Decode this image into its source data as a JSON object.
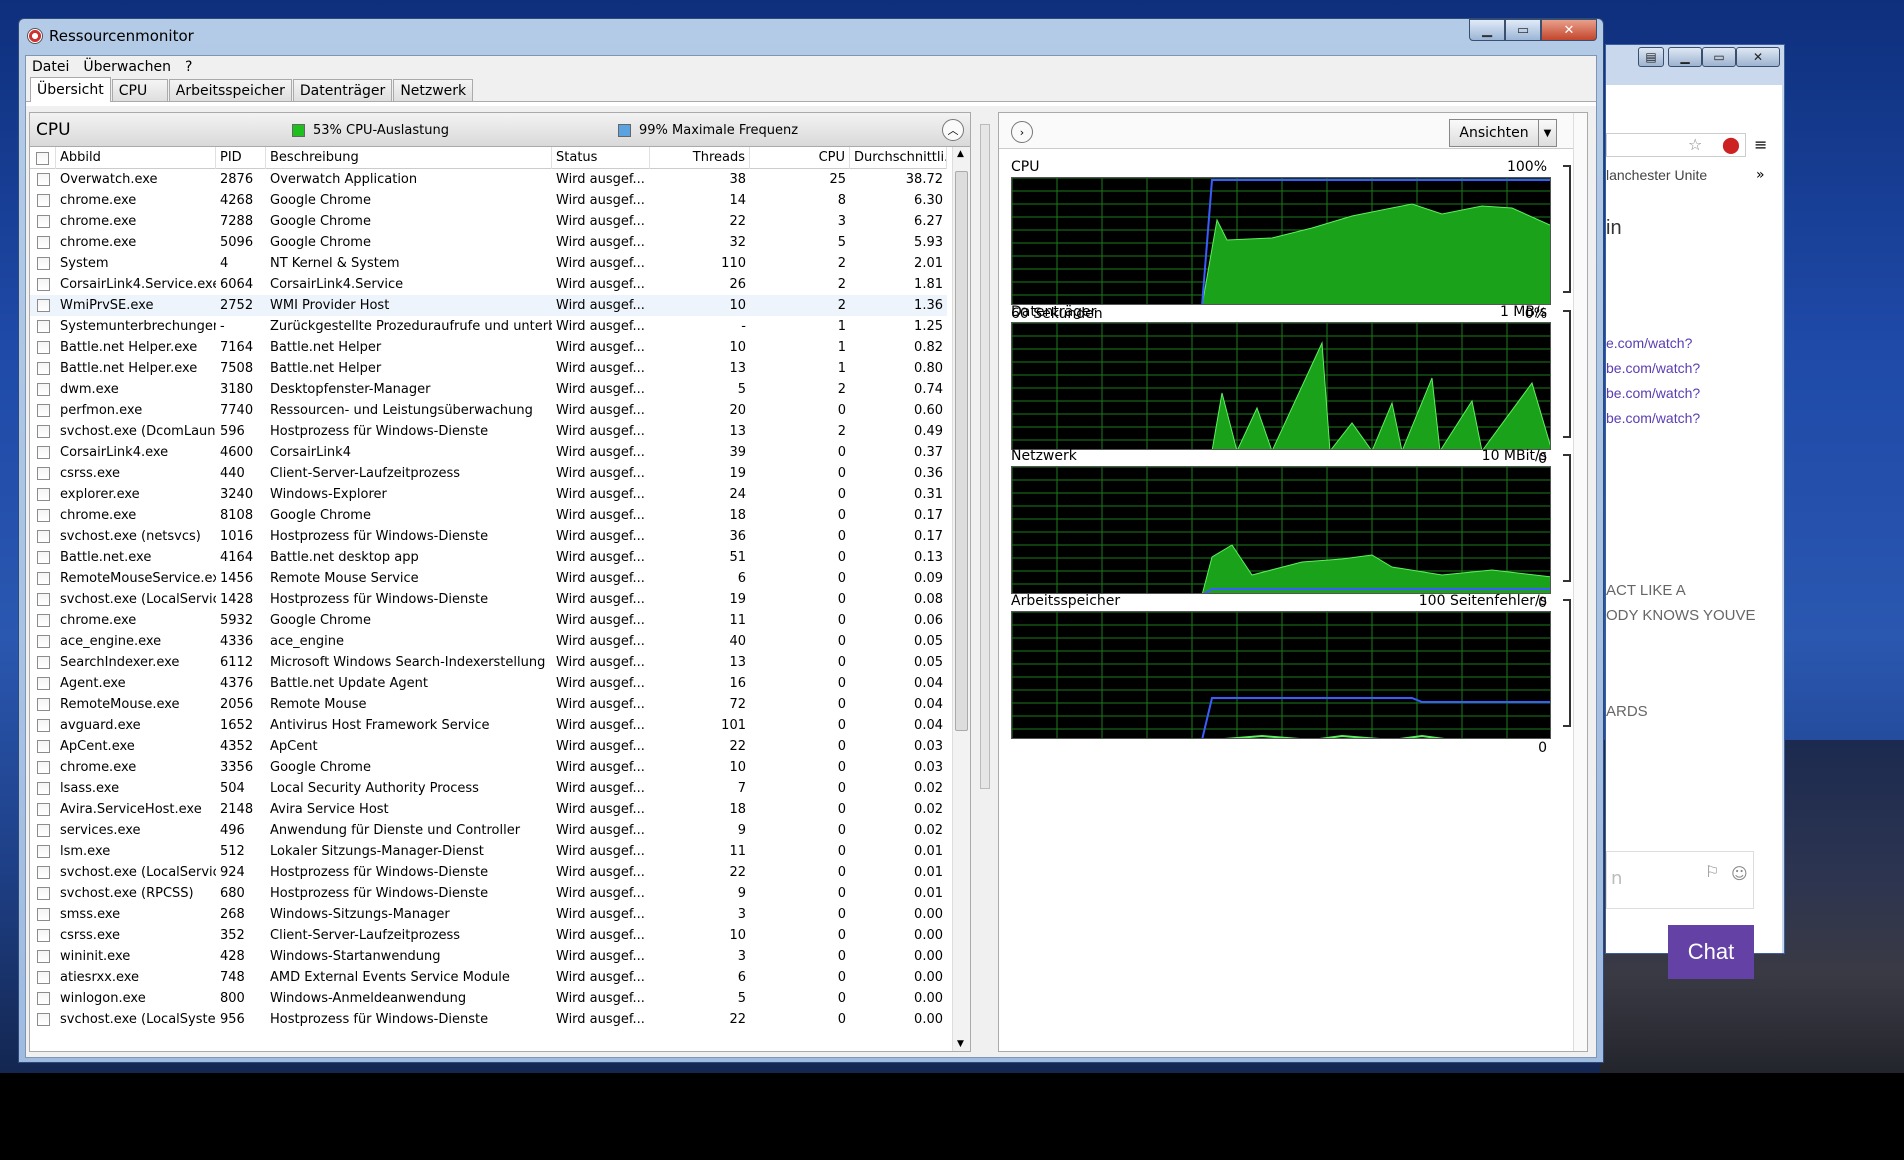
{
  "window": {
    "title": "Ressourcenmonitor",
    "min": "▁",
    "max": "▭",
    "close": "✕"
  },
  "menu": [
    "Datei",
    "Überwachen",
    "?"
  ],
  "tabs": [
    "Übersicht",
    "CPU",
    "Arbeitsspeicher",
    "Datenträger",
    "Netzwerk"
  ],
  "cpu_section": {
    "title": "CPU",
    "usage": "53% CPU-Auslastung",
    "usage_color": "#1fbf1f",
    "maxfreq": "99% Maximale Frequenz",
    "maxfreq_color": "#5ba3e0"
  },
  "columns": [
    "Abbild",
    "PID",
    "Beschreibung",
    "Status",
    "Threads",
    "CPU",
    "Durchschnittli..."
  ],
  "rows": [
    [
      "Overwatch.exe",
      "2876",
      "Overwatch Application",
      "Wird ausgef...",
      "38",
      "25",
      "38.72"
    ],
    [
      "chrome.exe",
      "4268",
      "Google Chrome",
      "Wird ausgef...",
      "14",
      "8",
      "6.30"
    ],
    [
      "chrome.exe",
      "7288",
      "Google Chrome",
      "Wird ausgef...",
      "22",
      "3",
      "6.27"
    ],
    [
      "chrome.exe",
      "5096",
      "Google Chrome",
      "Wird ausgef...",
      "32",
      "5",
      "5.93"
    ],
    [
      "System",
      "4",
      "NT Kernel & System",
      "Wird ausgef...",
      "110",
      "2",
      "2.01"
    ],
    [
      "CorsairLink4.Service.exe",
      "6064",
      "CorsairLink4.Service",
      "Wird ausgef...",
      "26",
      "2",
      "1.81"
    ],
    [
      "WmiPrvSE.exe",
      "2752",
      "WMI Provider Host",
      "Wird ausgef...",
      "10",
      "2",
      "1.36"
    ],
    [
      "Systemunterbrechungen",
      "-",
      "Zurückgestellte Prozeduraufrufe und unterbr...",
      "Wird ausgef...",
      "-",
      "1",
      "1.25"
    ],
    [
      "Battle.net Helper.exe",
      "7164",
      "Battle.net Helper",
      "Wird ausgef...",
      "10",
      "1",
      "0.82"
    ],
    [
      "Battle.net Helper.exe",
      "7508",
      "Battle.net Helper",
      "Wird ausgef...",
      "13",
      "1",
      "0.80"
    ],
    [
      "dwm.exe",
      "3180",
      "Desktopfenster-Manager",
      "Wird ausgef...",
      "5",
      "2",
      "0.74"
    ],
    [
      "perfmon.exe",
      "7740",
      "Ressourcen- und Leistungsüberwachung",
      "Wird ausgef...",
      "20",
      "0",
      "0.60"
    ],
    [
      "svchost.exe (DcomLaunc...",
      "596",
      "Hostprozess für Windows-Dienste",
      "Wird ausgef...",
      "13",
      "2",
      "0.49"
    ],
    [
      "CorsairLink4.exe",
      "4600",
      "CorsairLink4",
      "Wird ausgef...",
      "39",
      "0",
      "0.37"
    ],
    [
      "csrss.exe",
      "440",
      "Client-Server-Laufzeitprozess",
      "Wird ausgef...",
      "19",
      "0",
      "0.36"
    ],
    [
      "explorer.exe",
      "3240",
      "Windows-Explorer",
      "Wird ausgef...",
      "24",
      "0",
      "0.31"
    ],
    [
      "chrome.exe",
      "8108",
      "Google Chrome",
      "Wird ausgef...",
      "18",
      "0",
      "0.17"
    ],
    [
      "svchost.exe (netsvcs)",
      "1016",
      "Hostprozess für Windows-Dienste",
      "Wird ausgef...",
      "36",
      "0",
      "0.17"
    ],
    [
      "Battle.net.exe",
      "4164",
      "Battle.net desktop app",
      "Wird ausgef...",
      "51",
      "0",
      "0.13"
    ],
    [
      "RemoteMouseService.exe",
      "1456",
      "Remote Mouse Service",
      "Wird ausgef...",
      "6",
      "0",
      "0.09"
    ],
    [
      "svchost.exe (LocalServic...",
      "1428",
      "Hostprozess für Windows-Dienste",
      "Wird ausgef...",
      "19",
      "0",
      "0.08"
    ],
    [
      "chrome.exe",
      "5932",
      "Google Chrome",
      "Wird ausgef...",
      "11",
      "0",
      "0.06"
    ],
    [
      "ace_engine.exe",
      "4336",
      "ace_engine",
      "Wird ausgef...",
      "40",
      "0",
      "0.05"
    ],
    [
      "SearchIndexer.exe",
      "6112",
      "Microsoft Windows Search-Indexerstellung",
      "Wird ausgef...",
      "13",
      "0",
      "0.05"
    ],
    [
      "Agent.exe",
      "4376",
      "Battle.net Update Agent",
      "Wird ausgef...",
      "16",
      "0",
      "0.04"
    ],
    [
      "RemoteMouse.exe",
      "2056",
      "Remote Mouse",
      "Wird ausgef...",
      "72",
      "0",
      "0.04"
    ],
    [
      "avguard.exe",
      "1652",
      "Antivirus Host Framework Service",
      "Wird ausgef...",
      "101",
      "0",
      "0.04"
    ],
    [
      "ApCent.exe",
      "4352",
      "ApCent",
      "Wird ausgef...",
      "22",
      "0",
      "0.03"
    ],
    [
      "chrome.exe",
      "3356",
      "Google Chrome",
      "Wird ausgef...",
      "10",
      "0",
      "0.03"
    ],
    [
      "lsass.exe",
      "504",
      "Local Security Authority Process",
      "Wird ausgef...",
      "7",
      "0",
      "0.02"
    ],
    [
      "Avira.ServiceHost.exe",
      "2148",
      "Avira Service Host",
      "Wird ausgef...",
      "18",
      "0",
      "0.02"
    ],
    [
      "services.exe",
      "496",
      "Anwendung für Dienste und Controller",
      "Wird ausgef...",
      "9",
      "0",
      "0.02"
    ],
    [
      "lsm.exe",
      "512",
      "Lokaler Sitzungs-Manager-Dienst",
      "Wird ausgef...",
      "11",
      "0",
      "0.01"
    ],
    [
      "svchost.exe (LocalServic...",
      "924",
      "Hostprozess für Windows-Dienste",
      "Wird ausgef...",
      "22",
      "0",
      "0.01"
    ],
    [
      "svchost.exe (RPCSS)",
      "680",
      "Hostprozess für Windows-Dienste",
      "Wird ausgef...",
      "9",
      "0",
      "0.01"
    ],
    [
      "smss.exe",
      "268",
      "Windows-Sitzungs-Manager",
      "Wird ausgef...",
      "3",
      "0",
      "0.00"
    ],
    [
      "csrss.exe",
      "352",
      "Client-Server-Laufzeitprozess",
      "Wird ausgef...",
      "10",
      "0",
      "0.00"
    ],
    [
      "wininit.exe",
      "428",
      "Windows-Startanwendung",
      "Wird ausgef...",
      "3",
      "0",
      "0.00"
    ],
    [
      "atiesrxx.exe",
      "748",
      "AMD External Events Service Module",
      "Wird ausgef...",
      "6",
      "0",
      "0.00"
    ],
    [
      "winlogon.exe",
      "800",
      "Windows-Anmeldeanwendung",
      "Wird ausgef...",
      "5",
      "0",
      "0.00"
    ],
    [
      "svchost.exe (LocalSyste...",
      "956",
      "Hostprozess für Windows-Dienste",
      "Wird ausgef...",
      "22",
      "0",
      "0.00"
    ]
  ],
  "right": {
    "views_label": "Ansichten",
    "graphs": [
      {
        "name": "CPU",
        "max": "100%",
        "footer_left": "60 Sekunden",
        "footer_right": "0%"
      },
      {
        "name": "Datenträger",
        "max": "1 MB/s",
        "footer_left": "",
        "footer_right": "0"
      },
      {
        "name": "Netzwerk",
        "max": "10 MBit/s",
        "footer_left": "",
        "footer_right": "0"
      },
      {
        "name": "Arbeitsspeicher",
        "max": "100 Seitenfehler/s",
        "footer_left": "",
        "footer_right": "0"
      }
    ]
  },
  "background_window": {
    "tab_text": "lanchester Unite",
    "links": [
      "e.com/watch?",
      "be.com/watch?",
      "be.com/watch?",
      "be.com/watch?"
    ],
    "heading": "in",
    "texts": [
      "ACT LIKE A",
      "ODY KNOWS YOUVE",
      "ARDS"
    ],
    "chat_placeholder": "n",
    "chat_button": "Chat"
  }
}
